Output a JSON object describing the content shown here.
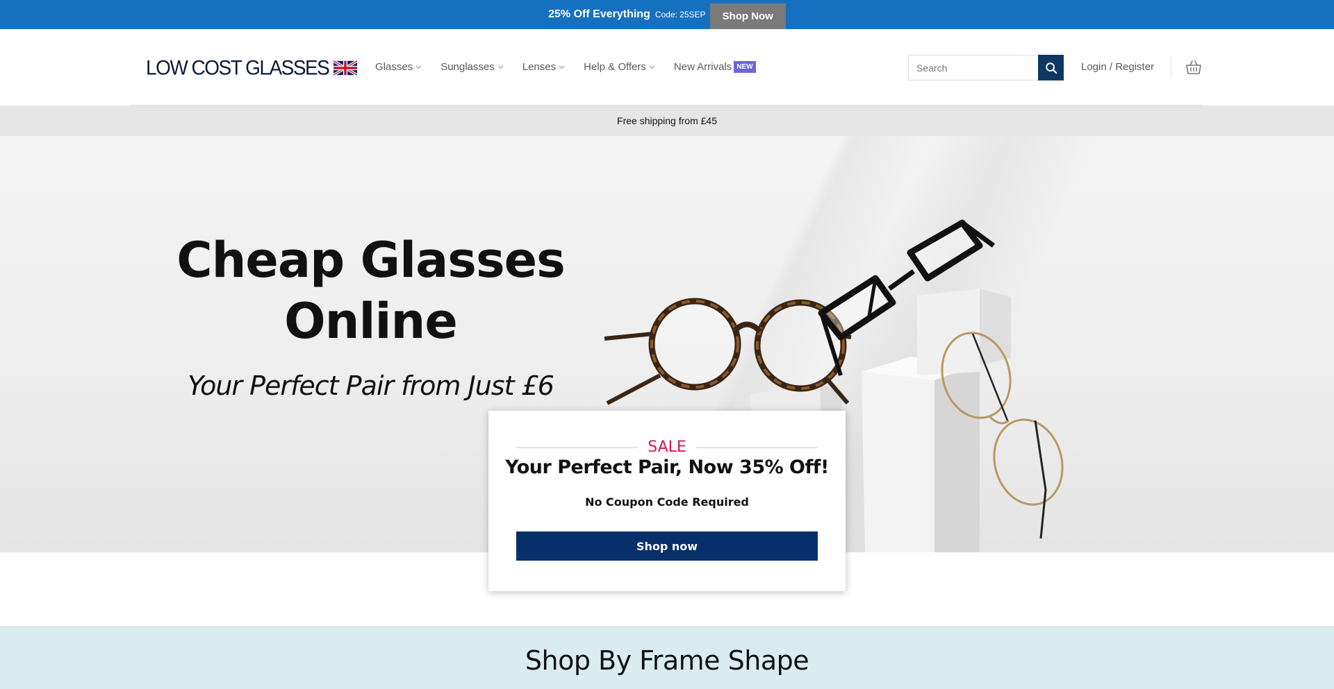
{
  "promo": {
    "headline": "25% Off Everything",
    "code": "Code: 25SEP",
    "button": "Shop Now",
    "bg_color": "#1670c0"
  },
  "header": {
    "logo_text": "LOW COST GLASSES",
    "nav": [
      {
        "label": "Glasses",
        "icon": "chevron-down-icon"
      },
      {
        "label": "Sunglasses",
        "icon": "chevron-down-icon"
      },
      {
        "label": "Lenses",
        "icon": "chevron-down-icon"
      },
      {
        "label": "Help & Offers",
        "icon": "chevron-down-icon"
      },
      {
        "label": "New Arrivals",
        "badge": "NEW"
      }
    ],
    "search_placeholder": "Search",
    "login": "Login / Register",
    "cart_icon": "basket-icon",
    "search_icon": "search-icon"
  },
  "shipping": {
    "text": "Free shipping from £45"
  },
  "hero": {
    "title_line1": "Cheap Glasses",
    "title_line2": "Online",
    "subtitle": "Your Perfect Pair from Just £6"
  },
  "sale_card": {
    "label": "SALE",
    "title": "Your Perfect Pair, Now 35% Off!",
    "note": "No Coupon Code Required",
    "button": "Shop now",
    "accent": "#d7174f",
    "button_color": "#07306a"
  },
  "frame_shape": {
    "title": "Shop By Frame Shape",
    "bg_color": "#dbecf1"
  }
}
